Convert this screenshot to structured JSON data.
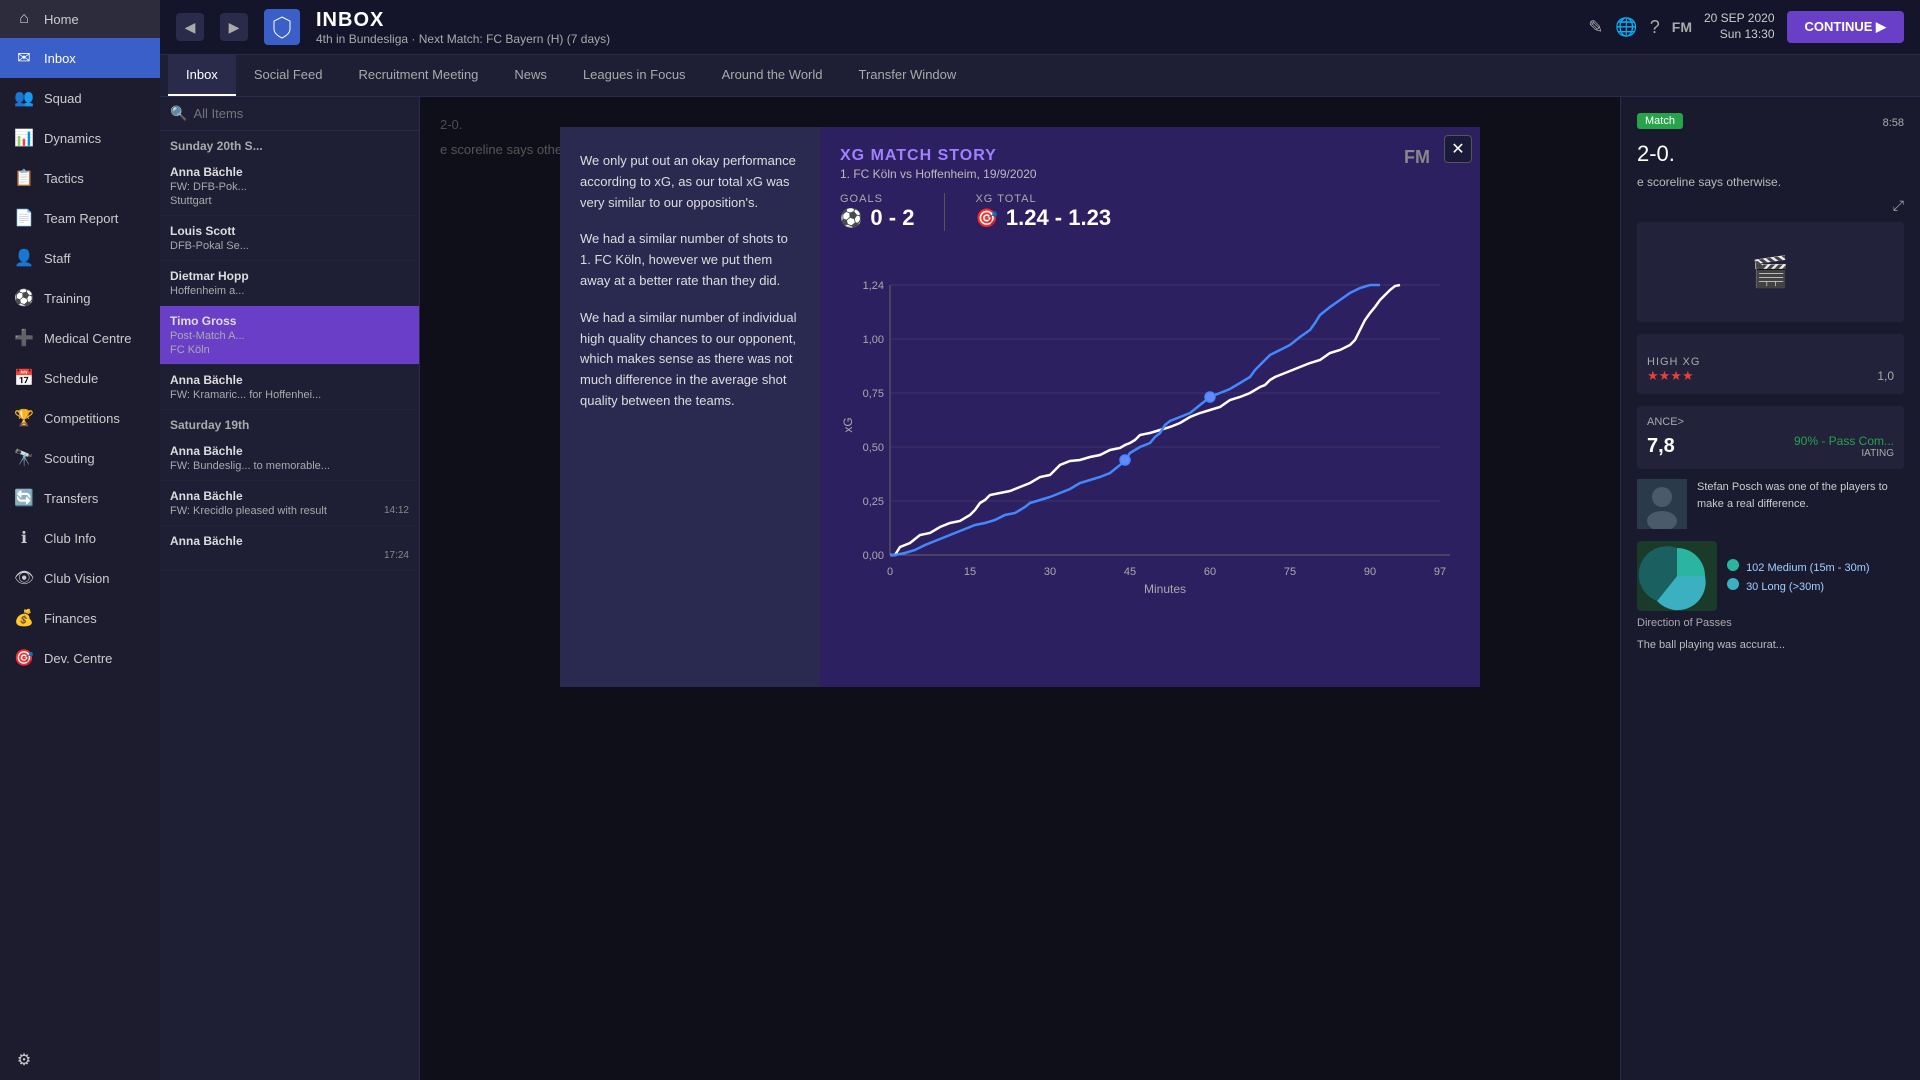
{
  "topbar": {
    "back_label": "◀",
    "forward_label": "▶",
    "title": "INBOX",
    "subtitle": "4th in Bundesliga · Next Match: FC Bayern (H) (7 days)",
    "date": "20 SEP 2020",
    "time": "Sun 13:30",
    "continue_label": "CONTINUE ▶",
    "fm_label": "FM",
    "edit_icon": "✎",
    "globe_icon": "🌐",
    "help_icon": "?"
  },
  "sidebar": {
    "items": [
      {
        "id": "home",
        "label": "Home",
        "icon": "⌂"
      },
      {
        "id": "inbox",
        "label": "Inbox",
        "icon": "✉",
        "active": true
      },
      {
        "id": "squad",
        "label": "Squad",
        "icon": "👥"
      },
      {
        "id": "dynamics",
        "label": "Dynamics",
        "icon": "📊"
      },
      {
        "id": "tactics",
        "label": "Tactics",
        "icon": "📋"
      },
      {
        "id": "team-report",
        "label": "Team Report",
        "icon": "📄"
      },
      {
        "id": "staff",
        "label": "Staff",
        "icon": "👤"
      },
      {
        "id": "training",
        "label": "Training",
        "icon": "⚽"
      },
      {
        "id": "medical",
        "label": "Medical Centre",
        "icon": "➕"
      },
      {
        "id": "schedule",
        "label": "Schedule",
        "icon": "📅"
      },
      {
        "id": "competitions",
        "label": "Competitions",
        "icon": "🏆"
      },
      {
        "id": "scouting",
        "label": "Scouting",
        "icon": "🔭"
      },
      {
        "id": "transfers",
        "label": "Transfers",
        "icon": "🔄"
      },
      {
        "id": "club-info",
        "label": "Club Info",
        "icon": "ℹ"
      },
      {
        "id": "club-vision",
        "label": "Club Vision",
        "icon": "👁"
      },
      {
        "id": "finances",
        "label": "Finances",
        "icon": "💰"
      },
      {
        "id": "dev-centre",
        "label": "Dev. Centre",
        "icon": "🎯"
      }
    ]
  },
  "tabs": [
    {
      "id": "inbox",
      "label": "Inbox",
      "active": true
    },
    {
      "id": "social-feed",
      "label": "Social Feed"
    },
    {
      "id": "recruitment",
      "label": "Recruitment Meeting"
    },
    {
      "id": "news",
      "label": "News"
    },
    {
      "id": "leagues",
      "label": "Leagues in Focus"
    },
    {
      "id": "around-world",
      "label": "Around the World"
    },
    {
      "id": "transfer-window",
      "label": "Transfer Window"
    }
  ],
  "search": {
    "placeholder": "All Items"
  },
  "messages": {
    "date_sunday": "Sunday 20th S...",
    "date_saturday": "Saturday 19th",
    "items": [
      {
        "sender": "Anna Bächle",
        "subject": "FW: DFB-Pok...",
        "time": ""
      },
      {
        "sender": "",
        "subject": "Stuttgart",
        "time": ""
      },
      {
        "sender": "Louis Scott",
        "subject": "DFB-Pokal Se...",
        "time": ""
      },
      {
        "sender": "Dietmar Hopp",
        "subject": "Hoffenheim a...",
        "time": ""
      },
      {
        "sender": "Timo Gross",
        "subject": "Post-Match A... FC Köln",
        "time": "",
        "active": true
      },
      {
        "sender": "Anna Bächle",
        "subject": "FW: Kramaric... for Hoffenhei...",
        "time": ""
      },
      {
        "sender": "Anna Bächle",
        "subject": "FW: Bundeslig... to memorable...",
        "time": ""
      },
      {
        "sender": "Anna Bächle",
        "subject": "FW: Krecidlo pleased with result",
        "time": "14:12"
      },
      {
        "sender": "Anna Bächle",
        "subject": "",
        "time": "17:24"
      }
    ]
  },
  "modal": {
    "title": "XG MATCH STORY",
    "subtitle": "1. FC Köln vs Hoffenheim, 19/9/2020",
    "goals_label": "GOALS",
    "goals_value": "0 - 2",
    "xg_label": "XG TOTAL",
    "xg_value": "1.24 - 1.23",
    "fm_watermark": "FM",
    "close_icon": "✕",
    "text1": "We only put out an okay performance according to xG, as our total xG was very similar to our opposition's.",
    "text2": "We had a similar number of shots to 1. FC Köln, however we put them away at a better rate than they did.",
    "text3": "We had a similar number of individual high quality chances to our opponent, which makes sense as there was not much difference in the average shot quality between the teams.",
    "chart": {
      "y_label": "xG",
      "x_label": "Minutes",
      "y_max": "1,24",
      "y_75": "1,00",
      "y_50": "0,75",
      "y_25": "0,50",
      "y_10": "0,25",
      "y_0": "0,00",
      "x_ticks": [
        "0",
        "15",
        "30",
        "45",
        "60",
        "75",
        "90",
        "97"
      ]
    }
  },
  "right_panel": {
    "match_badge": "Match",
    "match_time": "8:58",
    "score": "2-0.",
    "scoreline_text": "e scoreline says otherwise.",
    "high_xg_label": "HIGH XG",
    "stars": "★★★★",
    "xg_val": "1,0",
    "performance_label": "ANCE>",
    "rating": "7,8",
    "pass_pct": "90% - Pass Com...",
    "rating_label": "IATING",
    "player_text": "Stefan Posch was one of the players to make a real difference.",
    "bottom_text": "The ball playing was accurat...",
    "dir_passes_label": "Direction of Passes",
    "medium_label": "Medium (15m - 30m)",
    "medium_count": "102",
    "long_label": "Long (>30m)",
    "long_count": "30"
  }
}
